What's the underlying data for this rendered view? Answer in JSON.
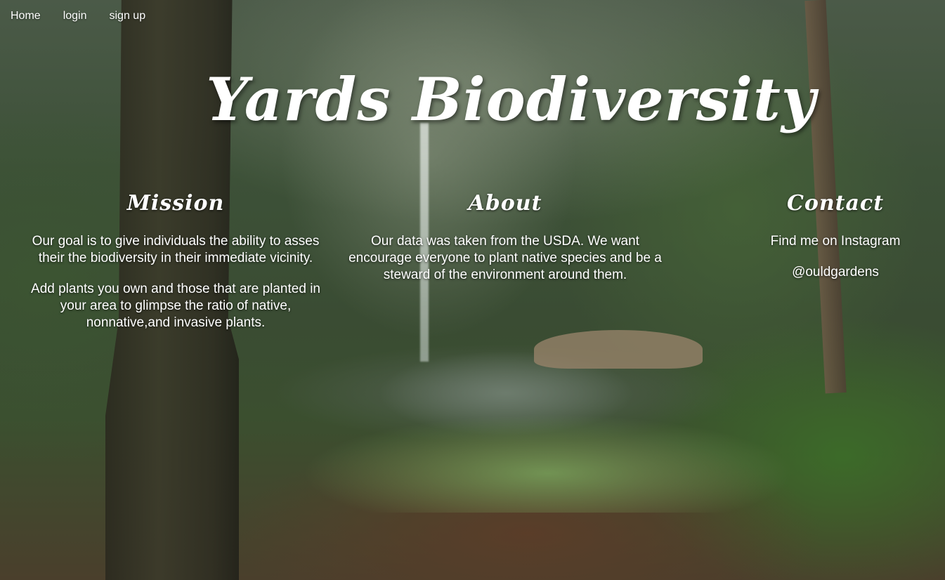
{
  "nav": {
    "items": [
      {
        "label": "Home"
      },
      {
        "label": "login"
      },
      {
        "label": "sign up"
      }
    ]
  },
  "hero": {
    "title": "Yards Biodiversity"
  },
  "mission": {
    "heading": "Mission",
    "paragraphs": [
      "Our goal is to give individuals the ability to asses their the biodiversity in their immediate vicinity.",
      "Add plants you own and those that are planted in your area to glimpse the ratio of native, nonnative,and invasive plants."
    ]
  },
  "about": {
    "heading": "About",
    "paragraphs": [
      "Our data was taken from the USDA. We want encourage everyone to plant native species and be a steward of the environment around them."
    ]
  },
  "contact": {
    "heading": "Contact",
    "lines": [
      "Find me on Instagram",
      "@ouldgardens"
    ]
  },
  "colors": {
    "text": "#ffffff",
    "background_tint": "#3a4c33"
  }
}
